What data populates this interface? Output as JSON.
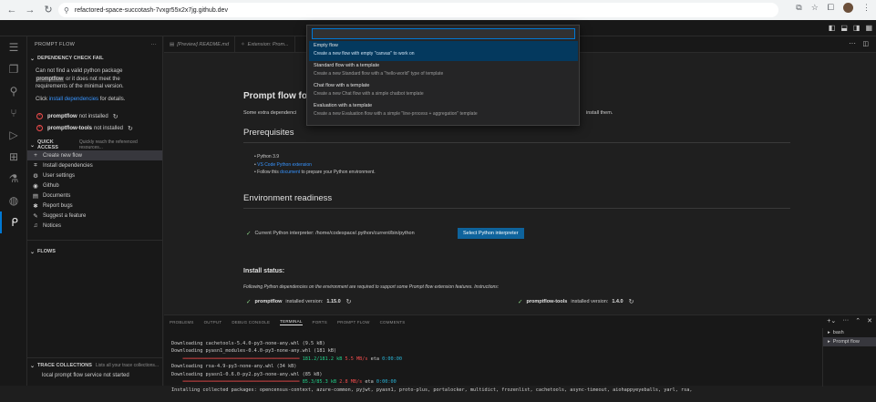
{
  "browser": {
    "url": "refactored-space-succotash-7vxgr55x2x7jg.github.dev"
  },
  "sidebar": {
    "title": "PROMPT FLOW",
    "dependency_section": "DEPENDENCY CHECK FAIL",
    "dep_msg_1": "Can not find a valid python package",
    "dep_msg_code": "promptflow",
    "dep_msg_2": "or it does not meet the",
    "dep_msg_3": "requirements of the minimal version.",
    "dep_click": "Click",
    "dep_link": "install dependencies",
    "dep_tail": "for details.",
    "status": [
      {
        "name": "promptflow",
        "state": "not installed"
      },
      {
        "name": "promptflow-tools",
        "state": "not installed"
      }
    ],
    "quick_access": "QUICK ACCESS",
    "quick_access_sub": "Quickly reach the referenced resources...",
    "items": [
      {
        "icon": "+",
        "label": "Create new flow"
      },
      {
        "icon": "⌗",
        "label": "Install dependencies"
      },
      {
        "icon": "⚙",
        "label": "User settings"
      },
      {
        "icon": "◉",
        "label": "Github"
      },
      {
        "icon": "▤",
        "label": "Documents"
      },
      {
        "icon": "✱",
        "label": "Report bugs"
      },
      {
        "icon": "✎",
        "label": "Suggest a feature"
      },
      {
        "icon": "♫",
        "label": "Notices"
      }
    ],
    "flows": "FLOWS",
    "trace_section": "TRACE COLLECTIONS",
    "trace_sub": "Lists all your trace collections...",
    "trace_msg": "local prompt flow service not started"
  },
  "tabs": [
    {
      "label": "[Preview] README.md"
    },
    {
      "label": "Extension: Prom..."
    }
  ],
  "palette": {
    "items": [
      {
        "title": "Empty flow",
        "desc": "Create a new flow with empty \"canvas\" to work on"
      },
      {
        "title": "Standard flow with a template",
        "desc": "Create a new Standard flow with a \"hello-world\" type of template"
      },
      {
        "title": "Chat flow with a template",
        "desc": "Create a new Chat flow with a simple chatbot template"
      },
      {
        "title": "Evaluation with a template",
        "desc": "Create a new Evaluation flow with a simple \"line-process + aggregation\" template"
      }
    ]
  },
  "doc": {
    "title": "Prompt flow fo",
    "intro": "Some extra dependenci",
    "intro_tail": "install them.",
    "prereq_heading": "Prerequisites",
    "prereq_1": "Python 3.9",
    "prereq_2": "VS Code Python extension",
    "prereq_3_a": "Follow this",
    "prereq_3_link": "document",
    "prereq_3_b": "to prepare your Python environment.",
    "env_heading": "Environment readiness",
    "interpreter": "Current Python interpreter: /home/codespace/.python/current/bin/python",
    "select_button": "Select Python interpreter",
    "install_heading": "Install status:",
    "install_desc": "Following Python dependencies on the environment are required to support some Prompt flow extension features. Instructions:",
    "pkg1_name": "promptflow",
    "pkg1_label": "installed version:",
    "pkg1_version": "1.15.0",
    "pkg2_name": "promptflow-tools",
    "pkg2_label": "installed version:",
    "pkg2_version": "1.4.0"
  },
  "panel": {
    "tabs": [
      "PROBLEMS",
      "OUTPUT",
      "DEBUG CONSOLE",
      "TERMINAL",
      "PORTS",
      "PROMPT FLOW",
      "COMMENTS"
    ],
    "active_tab": "TERMINAL",
    "terminals": [
      "bash",
      "Prompt flow"
    ],
    "lines": {
      "l1": "Downloading cachetools-5.4.0-py3-none-any.whl (9.5 kB)",
      "l2": "Downloading pyasn1_modules-0.4.0-py3-none-any.whl (181 kB)",
      "l3_bar": "━━━━━━━━━━━━━━━━━━━━━━━━━━━━━━━━━━━━━━━━━",
      "l3_size": "181.2/181.2 kB",
      "l3_speed": "5.5 MB/s",
      "l3_eta_label": "eta",
      "l3_eta": "0:00:00",
      "l4": "Downloading rsa-4.9-py3-none-any.whl (34 kB)",
      "l5": "Downloading pyasn1-0.6.0-py2.py3-none-any.whl (85 kB)",
      "l6_bar": "━━━━━━━━━━━━━━━━━━━━━━━━━━━━━━━━━━━━━━━━━",
      "l6_size": "85.3/85.3 kB",
      "l6_speed": "2.8 MB/s",
      "l6_eta_label": "eta",
      "l6_eta": "0:00:00",
      "l7": "Installing collected packages: opencensus-context, azure-common, pyjwt, pyasn1, proto-plus, portalocker, multidict, frozenlist, cachetools, async-timeout, aiohappyeyeballs, yarl, rsa,"
    }
  }
}
